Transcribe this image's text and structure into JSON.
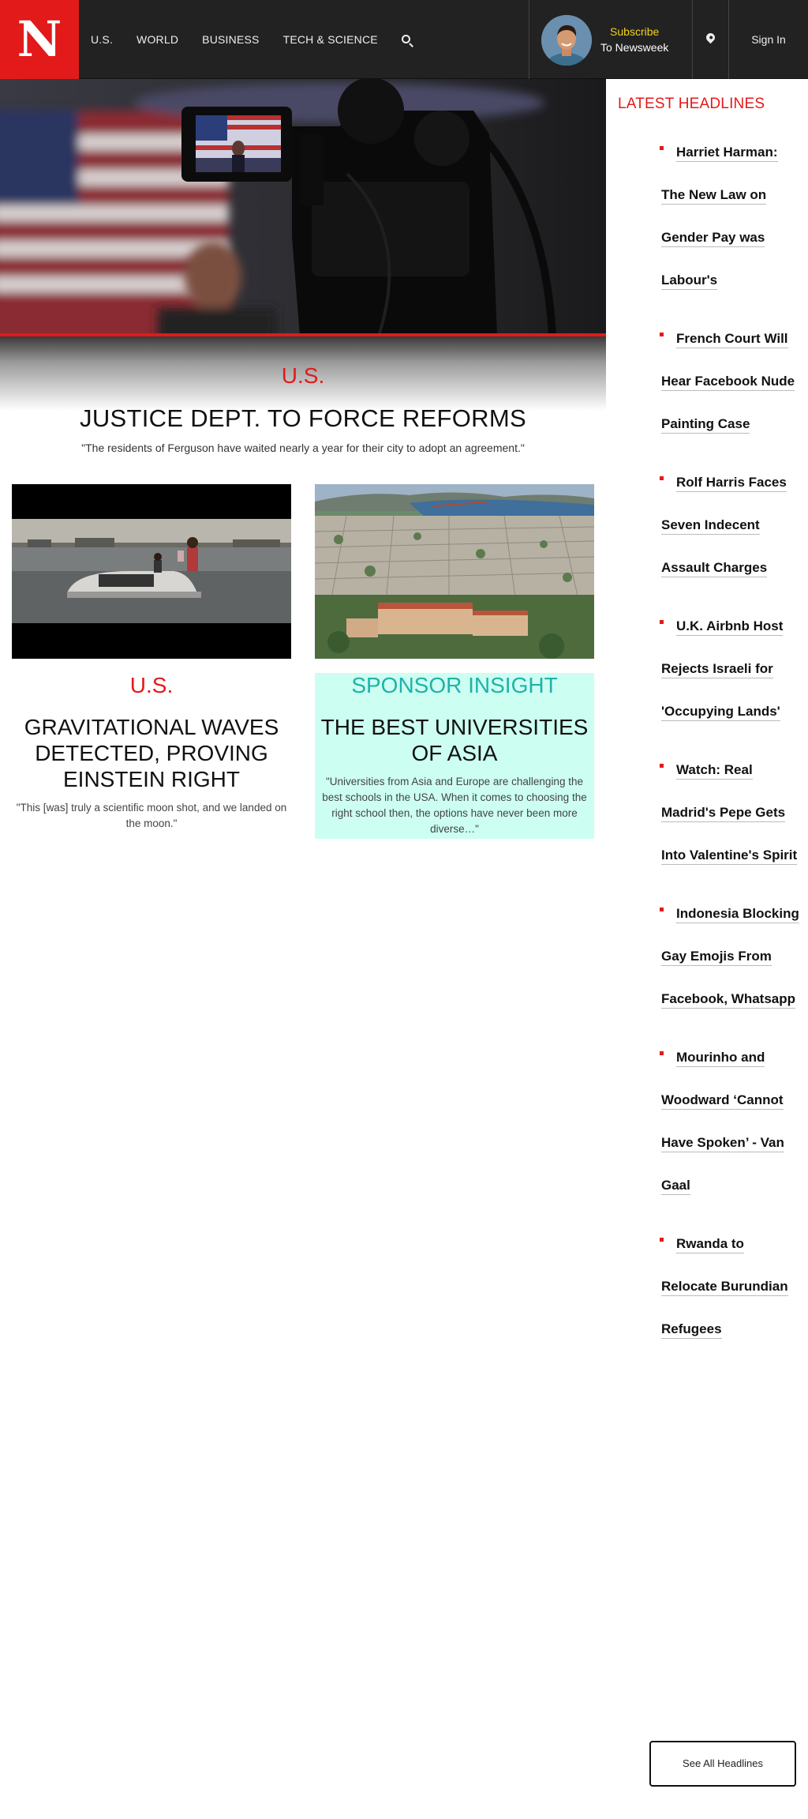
{
  "header": {
    "logo": "N",
    "nav": [
      "U.S.",
      "WORLD",
      "BUSINESS",
      "TECH & SCIENCE"
    ],
    "subscribe_line1": "Subscribe",
    "subscribe_line2": "To Newsweek",
    "signin": "Sign In"
  },
  "hero": {
    "category": "U.S.",
    "title": "JUSTICE DEPT. TO FORCE REFORMS",
    "subtitle": "\"The residents of Ferguson have waited nearly a year for their city to adopt an agreement.\""
  },
  "cards": [
    {
      "category": "U.S.",
      "title": "GRAVITATIONAL WAVES DETECTED, PROVING EINSTEIN RIGHT",
      "subtitle": "\"This [was] truly a scientific moon shot, and we landed on the moon.\""
    },
    {
      "category": "SPONSOR INSIGHT",
      "title": "THE BEST UNIVERSITIES OF ASIA",
      "subtitle": "\"Universities from Asia and Europe are challenging the best schools in the USA. When it comes to choosing the right school then, the options have never been more diverse…\""
    }
  ],
  "sidebar": {
    "heading": "LATEST HEADLINES",
    "headlines": [
      "Harriet Harman: The New Law on Gender Pay was Labour's",
      "French Court Will Hear Facebook Nude Painting Case",
      "Rolf Harris Faces Seven Indecent Assault Charges",
      "U.K. Airbnb Host Rejects Israeli for 'Occupying Lands'",
      "Watch: Real Madrid's Pepe Gets Into Valentine's Spirit",
      "Indonesia Blocking Gay Emojis From Facebook, Whatsapp",
      "Mourinho and Woodward ‘Cannot Have Spoken’ - Van Gaal",
      "Rwanda to Relocate Burundian Refugees"
    ],
    "see_all": "See All Headlines"
  },
  "colors": {
    "brand_red": "#e21a1a",
    "header_bg": "#222222",
    "subscribe_yellow": "#f2d21b",
    "sponsor_teal": "#20b2aa",
    "sponsor_bg": "#ccfff1"
  },
  "icons": [
    "search-icon",
    "location-pin-icon"
  ]
}
